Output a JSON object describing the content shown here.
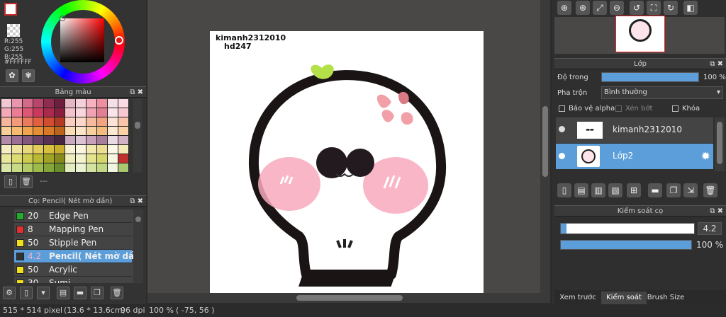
{
  "color": {
    "r_text": "R:255",
    "g_text": "G:255",
    "b_text": "B:255",
    "hex_text": "#FFFFFF",
    "foreground": "#ffffff",
    "accent": "#c62b2b"
  },
  "palette_panel": {
    "title": "Bảng màu",
    "footer_text": "---",
    "colors": [
      "#f2c6d3",
      "#e796ae",
      "#d46a8a",
      "#b7456c",
      "#8f2d50",
      "#6f1f3e",
      "#e5b7c5",
      "#f4d1da",
      "#f6b3bf",
      "#ec8fa1",
      "#f4e0e6",
      "#fadbe3",
      "#f5a9b8",
      "#ea7c95",
      "#dd5775",
      "#c9395d",
      "#a92a4c",
      "#872040",
      "#f3c3cc",
      "#f7d6dc",
      "#efa3b3",
      "#e37f94",
      "#f8e4e9",
      "#f9c9d2",
      "#f7b59c",
      "#f39a7c",
      "#ec7b5e",
      "#e2603f",
      "#d24d2f",
      "#b33a22",
      "#f9cdbf",
      "#fbd8c9",
      "#f6ba9c",
      "#f3a282",
      "#fde2d6",
      "#f9c4aa",
      "#f8cf98",
      "#f5bb71",
      "#f0a450",
      "#e78d34",
      "#d97826",
      "#bb621b",
      "#fadcb5",
      "#fbe5c8",
      "#f8cf9f",
      "#f4bb7f",
      "#fde9d2",
      "#fad1a6",
      "#b48ba8",
      "#9b6f93",
      "#84577d",
      "#6d4268",
      "#573252",
      "#44263f",
      "#c9a9bf",
      "#dcc3d4",
      "#c8a0bb",
      "#a97e9d",
      "#e9dae4",
      "#d1b1c6",
      "#f5eec2",
      "#efe49f",
      "#e9d97c",
      "#e2cd5b",
      "#d8bf3f",
      "#c9ad2c",
      "#f7f2d3",
      "#faf6e0",
      "#f2e8b0",
      "#ecdd92",
      "#fcf9eb",
      "#f3eab8",
      "#e9e89a",
      "#dcdc72",
      "#cccd4f",
      "#b8ba34",
      "#a0a326",
      "#868a1d",
      "#eeeebb",
      "#f3f3cf",
      "#e3e48e",
      "#d5d76c",
      "#f7f7e1",
      "#c03030",
      "#d9e6a8",
      "#c8da86",
      "#b4cc66",
      "#9dbb4b",
      "#84a638",
      "#6c8d2b",
      "#e3edc0",
      "#ebf2d2",
      "#d3e3a1",
      "#c2d783",
      "#f1f6e3",
      "#a8c76e"
    ]
  },
  "brush_panel": {
    "title": "Cọ: Pencil( Nét mờ dần)",
    "brushes": [
      {
        "size": "20",
        "name": "Edge Pen",
        "color": "#1fae2c"
      },
      {
        "size": "8",
        "name": "Mapping Pen",
        "color": "#e03030"
      },
      {
        "size": "50",
        "name": "Stipple Pen",
        "color": "#f0e020"
      },
      {
        "size": "4.2",
        "name": "Pencil( Nét mờ dần)",
        "color": "#333333"
      },
      {
        "size": "50",
        "name": "Acrylic",
        "color": "#f0e020"
      },
      {
        "size": "30",
        "name": "Sumi",
        "color": "#f0e020"
      }
    ]
  },
  "canvas": {
    "watermark_line1": "kimanh2312010",
    "watermark_line2": "hd247"
  },
  "layer_panel": {
    "title": "Lớp",
    "opacity_label": "Độ trong",
    "opacity_value": "100 %",
    "opacity_fraction": 1.0,
    "blend_label": "Pha trộn",
    "blend_value": "Bình thường",
    "protect_alpha": "Bảo vệ alpha",
    "clipping": "Xén bớt",
    "lock": "Khóa",
    "layers": [
      {
        "name": "kimanh2312010",
        "selected": false
      },
      {
        "name": "Lớp2",
        "selected": true
      }
    ]
  },
  "brush_control": {
    "title": "Kiểm soát cọ",
    "size_value": "4.2",
    "size_fraction": 0.04,
    "opacity_value": "100 %",
    "opacity_fraction": 1.0
  },
  "bottom_tabs": [
    "Xem trước cọ",
    "Kiểm soát cọ",
    "Brush Size"
  ],
  "status": {
    "dimensions": "515 * 514 pixel",
    "physical": "(13.6 * 13.6cm)",
    "dpi": "96 dpi",
    "zoom": "100 %",
    "coords": "( -75, 56 )"
  },
  "icons": [
    "zoom-in-icon",
    "zoom-out-icon",
    "fit-icon",
    "rotate-left-icon",
    "rotate-right-icon",
    "gear-icon",
    "trash-icon",
    "folder-icon",
    "new-layer-icon",
    "copy-icon"
  ]
}
